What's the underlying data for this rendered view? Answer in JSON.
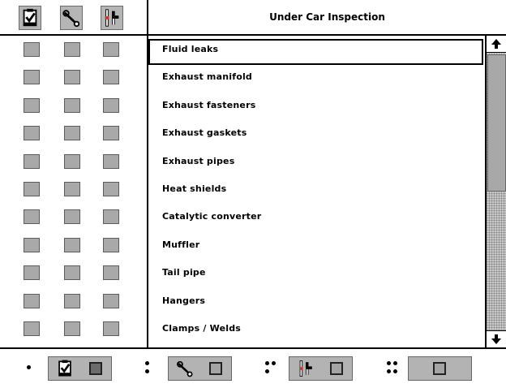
{
  "window": {
    "title": "Under Car Inspection"
  },
  "toolbar": {
    "icons": [
      "clipboard-check-icon",
      "wrench-icon",
      "parts-icon"
    ]
  },
  "items": [
    {
      "label": "Fluid leaks",
      "selected": true
    },
    {
      "label": "Exhaust manifold",
      "selected": false
    },
    {
      "label": "Exhaust fasteners",
      "selected": false
    },
    {
      "label": "Exhaust gaskets",
      "selected": false
    },
    {
      "label": "Exhaust pipes",
      "selected": false
    },
    {
      "label": "Heat shields",
      "selected": false
    },
    {
      "label": "Catalytic converter",
      "selected": false
    },
    {
      "label": "Muffler",
      "selected": false
    },
    {
      "label": "Tail pipe",
      "selected": false
    },
    {
      "label": "Hangers",
      "selected": false
    },
    {
      "label": "Clamps / Welds",
      "selected": false
    }
  ],
  "scrollbar": {
    "position": 0.0,
    "visible_fraction": 0.5
  },
  "footer": {
    "tabs": [
      {
        "dots": 1,
        "icon": "clipboard-check-icon",
        "active": true
      },
      {
        "dots": 2,
        "icon": "wrench-icon",
        "active": false
      },
      {
        "dots": 3,
        "icon": "parts-icon",
        "active": false
      },
      {
        "dots": 4,
        "icon": "",
        "active": false
      }
    ]
  },
  "colors": {
    "checkbox_fill": "#a9a9a9",
    "toolbar_fill": "#b5b5b5",
    "border": "#000000"
  }
}
